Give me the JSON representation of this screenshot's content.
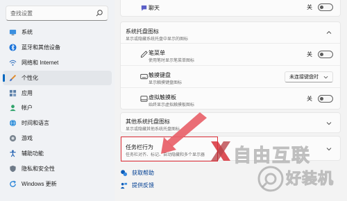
{
  "search": {
    "placeholder": "查找设置"
  },
  "sidebar": {
    "items": [
      {
        "label": "系统",
        "icon": "monitor-icon",
        "active": false
      },
      {
        "label": "蓝牙和其他设备",
        "icon": "bluetooth-icon",
        "active": false
      },
      {
        "label": "网络和 Internet",
        "icon": "wifi-icon",
        "active": false
      },
      {
        "label": "个性化",
        "icon": "brush-icon",
        "active": true
      },
      {
        "label": "应用",
        "icon": "apps-icon",
        "active": false
      },
      {
        "label": "帐户",
        "icon": "person-icon",
        "active": false
      },
      {
        "label": "时间和语言",
        "icon": "globe-clock-icon",
        "active": false
      },
      {
        "label": "游戏",
        "icon": "gamepad-icon",
        "active": false
      },
      {
        "label": "辅助功能",
        "icon": "accessibility-icon",
        "active": false
      },
      {
        "label": "隐私和安全性",
        "icon": "shield-icon",
        "active": false
      },
      {
        "label": "Windows 更新",
        "icon": "update-icon",
        "active": false
      }
    ]
  },
  "main": {
    "chat_row": {
      "label": "聊天",
      "state": "关"
    },
    "tray": {
      "title": "系统托盘图标",
      "desc": "显示或隐藏系统托盘中显示的图标",
      "pen": {
        "title": "笔菜单",
        "desc": "使用笔时显示笔菜单图标",
        "state": "关"
      },
      "touch_keyboard": {
        "title": "触摸键盘",
        "desc": "显示触摸键盘图标",
        "value": "未连接键盘时"
      },
      "touchpad": {
        "title": "虚拟触摸板",
        "desc": "始终显示虚拟触摸板图标",
        "state": "关"
      }
    },
    "other_tray": {
      "title": "其他系统托盘图标",
      "desc": "显示或隐藏其他系统托盘图标"
    },
    "behaviors": {
      "title": "任务栏行为",
      "desc": "任务栏对齐、标记、自动隐藏和多个显示器"
    },
    "links": {
      "help": "获取帮助",
      "feedback": "提供反馈"
    }
  },
  "colors": {
    "accent": "#0067c0",
    "highlight": "#e0303a",
    "arrow": "#e8626a"
  },
  "watermark": {
    "top": "自由互联",
    "bottom": "好装机"
  }
}
